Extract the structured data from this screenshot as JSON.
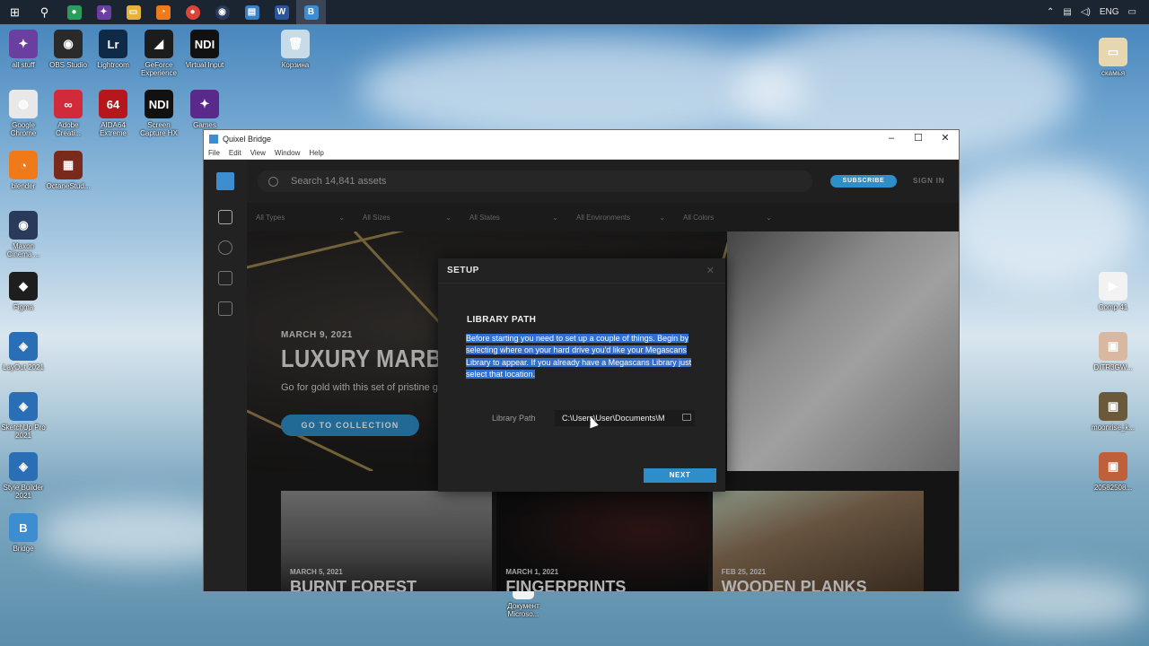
{
  "taskbar": {
    "icons": [
      "windows-start-icon",
      "search-icon",
      "chrome-app-icon",
      "purple-app-icon",
      "file-explorer-icon",
      "blender-app-icon",
      "chrome-icon",
      "cinema4d-icon",
      "media-icon",
      "word-icon",
      "bridge-icon"
    ],
    "tray": {
      "lang": "ENG"
    }
  },
  "desktop": {
    "left": [
      {
        "label": "all stuff",
        "color": "#6a3fa0",
        "glyph": "✦"
      },
      {
        "label": "OBS Studio",
        "color": "#2a2a2a",
        "glyph": "◉"
      },
      {
        "label": "Lightroom",
        "color": "#0e2a47",
        "glyph": "Lr"
      },
      {
        "label": "GeForce Experience",
        "color": "#1c1c1c",
        "glyph": "◢"
      },
      {
        "label": "Virtual Input",
        "color": "#111",
        "glyph": "NDI"
      },
      {
        "label": "Google Chrome",
        "color": "#e8e8e8",
        "glyph": "◍"
      },
      {
        "label": "Adobe Creati...",
        "color": "#d12a3a",
        "glyph": "∞"
      },
      {
        "label": "AIDA64 Extreme",
        "color": "#b5171c",
        "glyph": "64"
      },
      {
        "label": "Screen Capture HX",
        "color": "#111",
        "glyph": "NDI"
      },
      {
        "label": "Games",
        "color": "#5a2a8a",
        "glyph": "✦"
      },
      {
        "label": "blender",
        "color": "#f07a1a",
        "glyph": "◔"
      },
      {
        "label": "OctaneStud...",
        "color": "#7a2a1a",
        "glyph": "▦"
      },
      {
        "label": "Maxon Cinema ...",
        "color": "#2a3a5a",
        "glyph": "◉"
      },
      {
        "label": "Figma",
        "color": "#1e1e1e",
        "glyph": "◆"
      },
      {
        "label": "LayOut 2021",
        "color": "#2a6fb5",
        "glyph": "◈"
      },
      {
        "label": "SketchUp Pro 2021",
        "color": "#2a6fb5",
        "glyph": "◈"
      },
      {
        "label": "Style Builder 2021",
        "color": "#2a6fb5",
        "glyph": "◈"
      },
      {
        "label": "Bridge",
        "color": "#3d8ed0",
        "glyph": "B"
      },
      {
        "label": "Корзина",
        "color": "#c8dce8",
        "glyph": "🗑"
      }
    ],
    "right": [
      {
        "label": "скамья",
        "color": "#e6d7b0",
        "glyph": "▭"
      },
      {
        "label": "Comp 41",
        "color": "#f2f2f2",
        "glyph": "▶"
      },
      {
        "label": "DITR3GW...",
        "color": "#d8b8a0",
        "glyph": "▣"
      },
      {
        "label": "moonrise_k...",
        "color": "#6a5a3a",
        "glyph": "▣"
      },
      {
        "label": "20582508...",
        "color": "#c0603a",
        "glyph": "▣"
      }
    ],
    "center_file": "Документ Microso..."
  },
  "window": {
    "title": "Quixel Bridge",
    "menu": [
      "File",
      "Edit",
      "View",
      "Window",
      "Help"
    ]
  },
  "bridge": {
    "search_placeholder": "Search 14,841 assets",
    "subscribe": "SUBSCRIBE",
    "signin": "SIGN IN",
    "filters": [
      "All Types",
      "All Sizes",
      "All States",
      "All Environments",
      "All Colors"
    ],
    "hero": {
      "date": "MARCH 9, 2021",
      "title": "LUXURY MARBLE",
      "subtitle": "Go for gold with this set of pristine g",
      "button": "GO TO COLLECTION"
    },
    "cards": [
      {
        "date": "MARCH 5, 2021",
        "title": "BURNT FOREST"
      },
      {
        "date": "MARCH 1, 2021",
        "title": "FINGERPRINTS"
      },
      {
        "date": "FEB 25, 2021",
        "title": "WOODEN PLANKS"
      }
    ]
  },
  "modal": {
    "header": "SETUP",
    "section_title": "LIBRARY PATH",
    "description": "Before starting you need to set up a couple of things. Begin by selecting where on your hard drive you'd like your Megascans Library to appear. If you already have a Megascans Library just select that location.",
    "path_label": "Library Path",
    "path_value": "C:\\Users\\User\\Documents\\M",
    "next": "NEXT"
  }
}
